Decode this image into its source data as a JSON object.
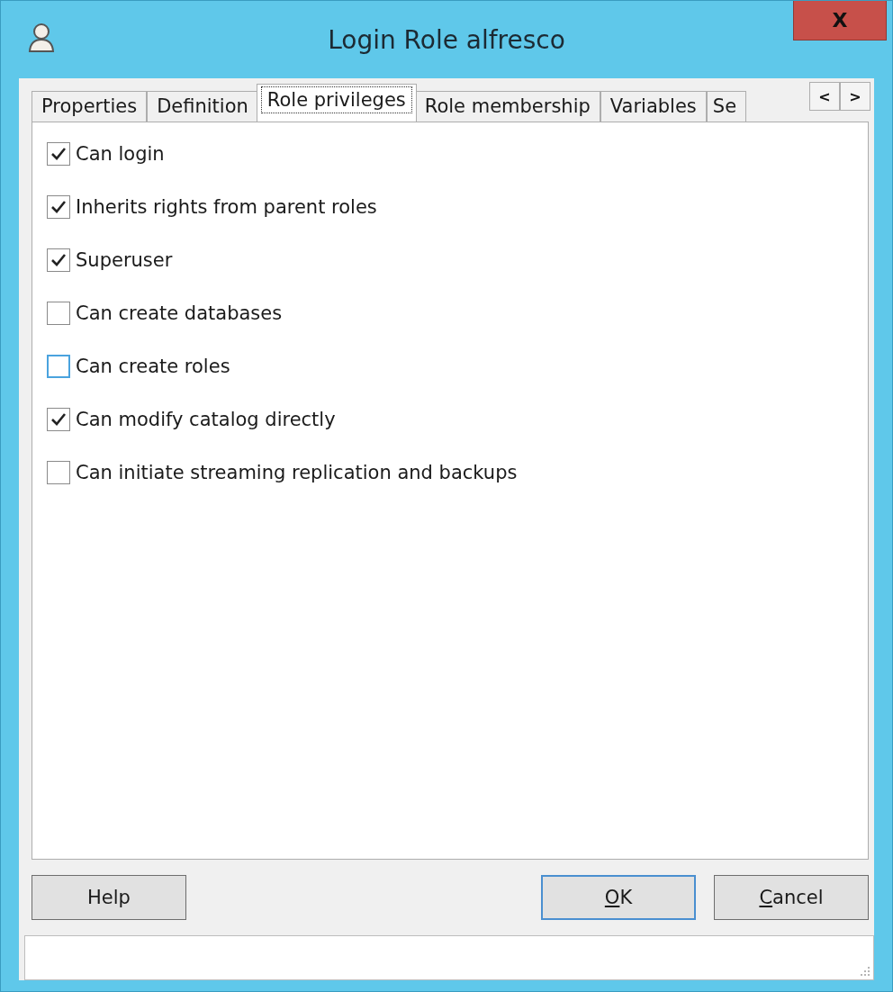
{
  "window": {
    "title": "Login Role alfresco",
    "close": "X"
  },
  "tabs": [
    {
      "label": "Properties",
      "selected": false
    },
    {
      "label": "Definition",
      "selected": false
    },
    {
      "label": "Role privileges",
      "selected": true
    },
    {
      "label": "Role membership",
      "selected": false
    },
    {
      "label": "Variables",
      "selected": false
    },
    {
      "label": "Se",
      "selected": false
    }
  ],
  "tab_scroll": [
    "<",
    ">"
  ],
  "privileges": [
    {
      "label": "Can login",
      "checked": true,
      "focused": false
    },
    {
      "label": "Inherits rights from parent roles",
      "checked": true,
      "focused": false
    },
    {
      "label": "Superuser",
      "checked": true,
      "focused": false
    },
    {
      "label": "Can create databases",
      "checked": false,
      "focused": false
    },
    {
      "label": "Can create roles",
      "checked": false,
      "focused": true
    },
    {
      "label": "Can modify catalog directly",
      "checked": true,
      "focused": false
    },
    {
      "label": "Can initiate streaming replication and backups",
      "checked": false,
      "focused": false
    }
  ],
  "buttons": [
    {
      "rest": "Help",
      "default": false
    },
    {
      "key": "O",
      "rest": "K",
      "default": true
    },
    {
      "key": "C",
      "rest": "ancel",
      "default": false
    }
  ]
}
